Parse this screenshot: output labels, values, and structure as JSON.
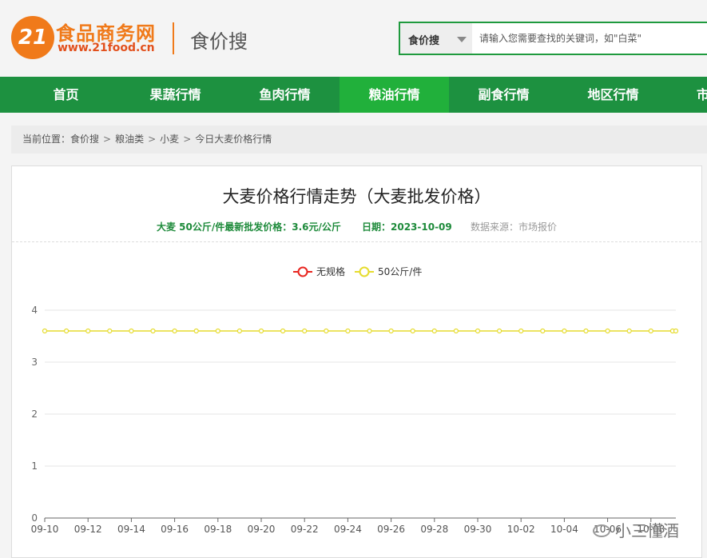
{
  "header": {
    "logo_badge": "21",
    "logo_title": "食品商务网",
    "logo_url": "www.21food.cn",
    "site_name": "食价搜"
  },
  "search": {
    "select_label": "食价搜",
    "placeholder": "请输入您需要查找的关键词，如\"白菜\""
  },
  "nav": {
    "items": [
      {
        "label": "首页"
      },
      {
        "label": "果蔬行情"
      },
      {
        "label": "鱼肉行情"
      },
      {
        "label": "粮油行情",
        "active": true
      },
      {
        "label": "副食行情"
      },
      {
        "label": "地区行情"
      },
      {
        "label": "市"
      }
    ]
  },
  "breadcrumb": {
    "prefix": "当前位置：",
    "items": [
      "食价搜",
      "粮油类",
      "小麦",
      "今日大麦价格行情"
    ]
  },
  "panel": {
    "title": "大麦价格行情走势（大麦批发价格）",
    "latest_price": "大麦 50公斤/件最新批发价格：3.6元/公斤",
    "date": "日期：2023-10-09",
    "source": "数据来源：市场报价"
  },
  "chart_data": {
    "type": "line",
    "x": [
      "09-10",
      "09-11",
      "09-12",
      "09-13",
      "09-14",
      "09-15",
      "09-16",
      "09-17",
      "09-18",
      "09-19",
      "09-20",
      "09-21",
      "09-22",
      "09-23",
      "09-24",
      "09-25",
      "09-26",
      "09-27",
      "09-28",
      "09-29",
      "09-30",
      "10-01",
      "10-02",
      "10-03",
      "10-04",
      "10-05",
      "10-06",
      "10-07",
      "10-08",
      "10-09"
    ],
    "x_tick_labels": [
      "09-10",
      "09-12",
      "09-14",
      "09-16",
      "09-18",
      "09-20",
      "09-22",
      "09-24",
      "09-26",
      "09-28",
      "09-30",
      "10-02",
      "10-04",
      "10-06",
      "10-08"
    ],
    "y_ticks": [
      0,
      1,
      2,
      3,
      4
    ],
    "ylim": [
      0,
      4
    ],
    "grid": true,
    "legend_position": "top-center",
    "series": [
      {
        "name": "无规格",
        "color": "#e8251f",
        "values": []
      },
      {
        "name": "50公斤/件",
        "color": "#e6dc2e",
        "values": [
          3.6,
          3.6,
          3.6,
          3.6,
          3.6,
          3.6,
          3.6,
          3.6,
          3.6,
          3.6,
          3.6,
          3.6,
          3.6,
          3.6,
          3.6,
          3.6,
          3.6,
          3.6,
          3.6,
          3.6,
          3.6,
          3.6,
          3.6,
          3.6,
          3.6,
          3.6,
          3.6,
          3.6,
          3.6,
          3.6
        ]
      }
    ]
  },
  "watermark": "小三懂酒",
  "colors": {
    "brand_orange": "#f07a1a",
    "nav_green": "#1d9140",
    "nav_active": "#21b03b",
    "meta_green": "#1d8a3a"
  }
}
